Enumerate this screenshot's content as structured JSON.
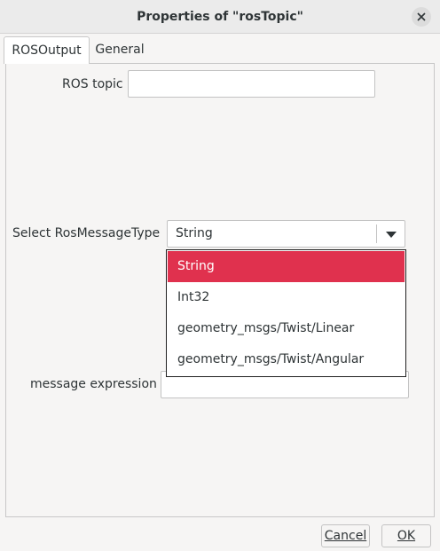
{
  "window": {
    "title": "Properties of \"rosTopic\"",
    "close_icon": "close-icon"
  },
  "tabs": [
    {
      "label": "ROSOutput",
      "active": true
    },
    {
      "label": "General",
      "active": false
    }
  ],
  "form": {
    "ros_topic_label": "ROS topic",
    "ros_topic_value": "",
    "message_type_label": "Select RosMessageType",
    "message_type_value": "String",
    "message_type_options": [
      "String",
      "Int32",
      "geometry_msgs/Twist/Linear",
      "geometry_msgs/Twist/Angular"
    ],
    "message_expression_label": "message expression",
    "message_expression_value": ""
  },
  "buttons": {
    "cancel": "Cancel",
    "ok": "OK"
  },
  "colors": {
    "selection": "#e0314e",
    "window_bg": "#f6f5f4"
  }
}
